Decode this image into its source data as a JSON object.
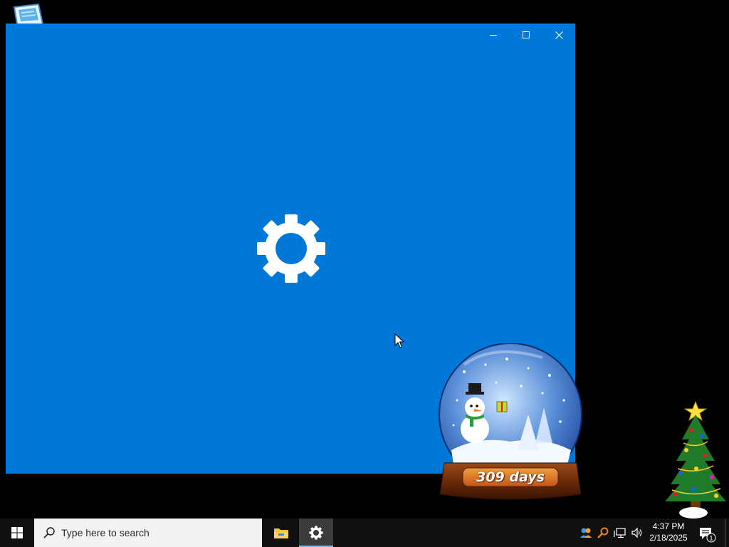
{
  "window": {
    "minimize_label": "Minimize",
    "maximize_label": "Maximize",
    "close_label": "Close",
    "background_color": "#0078d7",
    "splash_icon": "gear-icon"
  },
  "gadgets": {
    "snowglobe_text": "309 days",
    "tree_icon": "christmas-tree-icon"
  },
  "taskbar": {
    "search_placeholder": "Type here to search",
    "apps": [
      {
        "name": "File Explorer",
        "icon": "folder-icon"
      },
      {
        "name": "Settings",
        "icon": "gear-icon",
        "active": true
      }
    ],
    "tray": {
      "icons": [
        "people-icon",
        "search-icon",
        "network-icon",
        "volume-icon"
      ],
      "time": "4:37 PM",
      "date": "2/18/2025",
      "notification_count": "1"
    },
    "accent_color": "#76b9ed"
  }
}
